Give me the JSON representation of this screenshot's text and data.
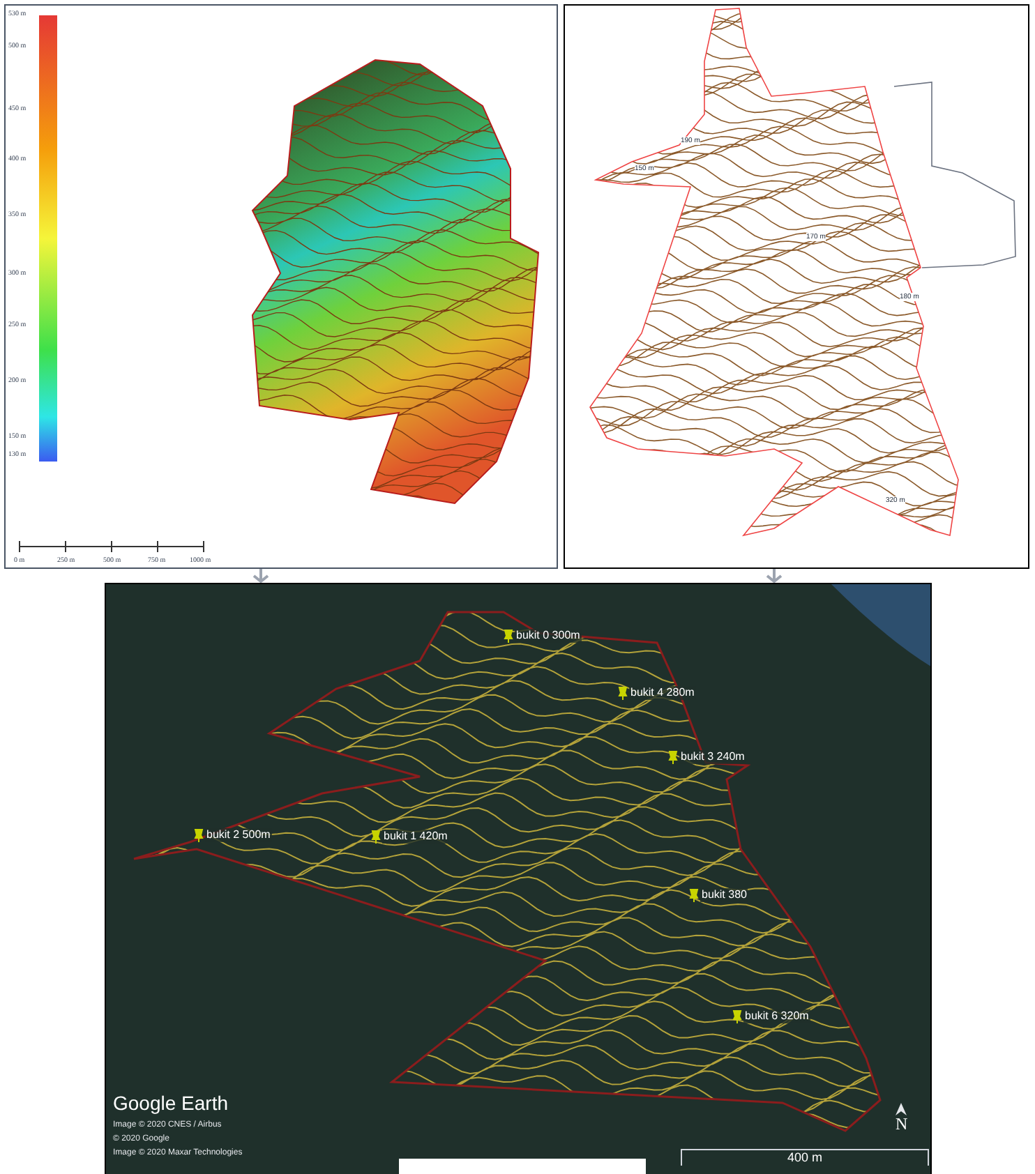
{
  "elevation_map": {
    "legend": {
      "labels": [
        "530 m",
        "500 m",
        "450 m",
        "400 m",
        "350 m",
        "300 m",
        "250 m",
        "200 m",
        "150 m",
        "130 m"
      ]
    },
    "scale_bar": {
      "labels": [
        "0 m",
        "250 m",
        "500 m",
        "750 m",
        "1000 m"
      ]
    }
  },
  "contour_map": {
    "labels": [
      "190 m",
      "150 m",
      "170 m",
      "180 m",
      "320 m"
    ]
  },
  "satellite_view": {
    "placemarks": [
      {
        "label": "bukit 0 300m"
      },
      {
        "label": "bukit 4 280m"
      },
      {
        "label": "bukit 3 240m"
      },
      {
        "label": "bukit 2 500m"
      },
      {
        "label": "bukit 1 420m"
      },
      {
        "label": "bukit 380"
      },
      {
        "label": "bukit 6 320m"
      }
    ],
    "logo": "Google Earth",
    "credits": [
      "Image © 2020 CNES / Airbus",
      "© 2020 Google",
      "Image © 2020 Maxar Technologies"
    ],
    "north_label": "N",
    "scale_label": "400 m"
  }
}
